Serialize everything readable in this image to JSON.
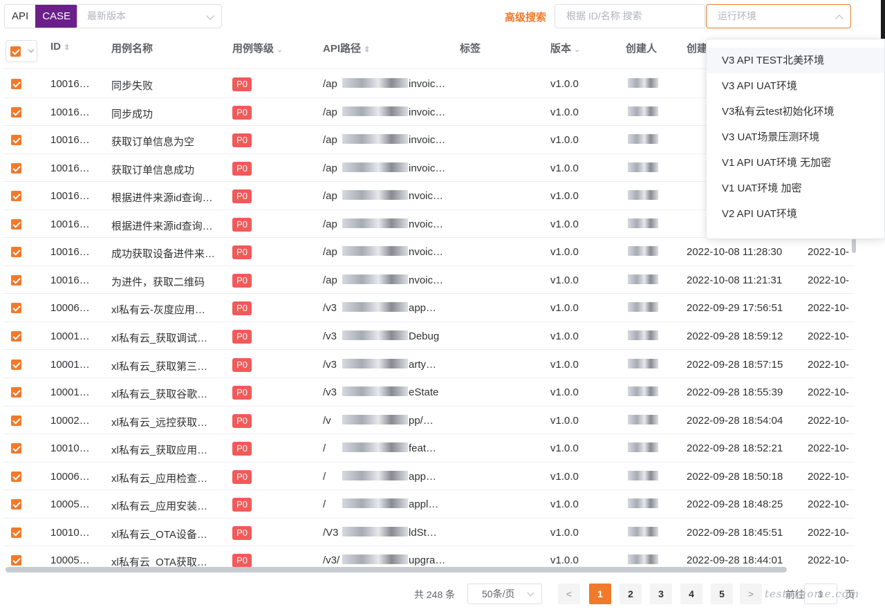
{
  "topbar": {
    "tab_api": "API",
    "tab_case": "CASE",
    "version_placeholder": "最新版本",
    "advanced_search": "高级搜索",
    "search_placeholder": "根据 ID/名称 搜索",
    "env_placeholder": "运行环境",
    "accent_color": "#f07a2a",
    "case_tab_color": "#6b1f8a"
  },
  "table": {
    "headers": {
      "id": "ID",
      "name": "用例名称",
      "level": "用例等级",
      "api_path": "API路径",
      "tags": "标签",
      "version": "版本",
      "creator": "创建人",
      "created": "创建"
    },
    "rows": [
      {
        "id": "10016…",
        "name": "同步失败",
        "level": "P0",
        "path": "/ap",
        "path_end": "invoic…",
        "version": "v1.0.0",
        "created_at": "",
        "updated_at": ""
      },
      {
        "id": "10016…",
        "name": "同步成功",
        "level": "P0",
        "path": "/ap",
        "path_end": "invoic…",
        "version": "v1.0.0",
        "created_at": "",
        "updated_at": ""
      },
      {
        "id": "10016…",
        "name": "获取订单信息为空",
        "level": "P0",
        "path": "/ap",
        "path_end": "invoic…",
        "version": "v1.0.0",
        "created_at": "",
        "updated_at": ""
      },
      {
        "id": "10016…",
        "name": "获取订单信息成功",
        "level": "P0",
        "path": "/ap",
        "path_end": "invoic…",
        "version": "v1.0.0",
        "created_at": "",
        "updated_at": ""
      },
      {
        "id": "10016…",
        "name": "根据进件来源id查询…",
        "level": "P0",
        "path": "/ap",
        "path_end": "nvoic…",
        "version": "v1.0.0",
        "created_at": "",
        "updated_at": ""
      },
      {
        "id": "10016…",
        "name": "根据进件来源id查询…",
        "level": "P0",
        "path": "/ap",
        "path_end": "nvoic…",
        "version": "v1.0.0",
        "created_at": "",
        "updated_at": ""
      },
      {
        "id": "10016…",
        "name": "成功获取设备进件来…",
        "level": "P0",
        "path": "/ap",
        "path_end": "nvoic…",
        "version": "v1.0.0",
        "created_at": "2022-10-08 11:28:30",
        "updated_at": "2022-10-"
      },
      {
        "id": "10016…",
        "name": "为进件，获取二维码",
        "level": "P0",
        "path": "/ap",
        "path_end": "nvoic…",
        "version": "v1.0.0",
        "created_at": "2022-10-08 11:21:31",
        "updated_at": "2022-10-"
      },
      {
        "id": "10006…",
        "name": "xl私有云-灰度应用…",
        "level": "P0",
        "path": "/v3",
        "path_end": "app…",
        "version": "v1.0.0",
        "created_at": "2022-09-29 17:56:51",
        "updated_at": "2022-10-"
      },
      {
        "id": "10001…",
        "name": "xl私有云_获取调试…",
        "level": "P0",
        "path": "/v3",
        "path_end": "Debug",
        "version": "v1.0.0",
        "created_at": "2022-09-28 18:59:12",
        "updated_at": "2022-10-"
      },
      {
        "id": "10001…",
        "name": "xl私有云_获取第三…",
        "level": "P0",
        "path": "/v3",
        "path_end": "arty…",
        "version": "v1.0.0",
        "created_at": "2022-09-28 18:57:15",
        "updated_at": "2022-10-"
      },
      {
        "id": "10001…",
        "name": "xl私有云_获取谷歌…",
        "level": "P0",
        "path": "/v3",
        "path_end": "eState",
        "version": "v1.0.0",
        "created_at": "2022-09-28 18:55:39",
        "updated_at": "2022-10-"
      },
      {
        "id": "10002…",
        "name": "xl私有云_远控获取…",
        "level": "P0",
        "path": "/v",
        "path_end": "pp/…",
        "version": "v1.0.0",
        "created_at": "2022-09-28 18:54:04",
        "updated_at": "2022-10-"
      },
      {
        "id": "10010…",
        "name": "xl私有云_获取应用…",
        "level": "P0",
        "path": "/",
        "path_end": "feat…",
        "version": "v1.0.0",
        "created_at": "2022-09-28 18:52:21",
        "updated_at": "2022-10-"
      },
      {
        "id": "10006…",
        "name": "xl私有云_应用检查…",
        "level": "P0",
        "path": "/",
        "path_end": "app…",
        "version": "v1.0.0",
        "created_at": "2022-09-28 18:50:18",
        "updated_at": "2022-10-"
      },
      {
        "id": "10005…",
        "name": "xl私有云_应用安装…",
        "level": "P0",
        "path": "/",
        "path_end": "appl…",
        "version": "v1.0.0",
        "created_at": "2022-09-28 18:48:25",
        "updated_at": "2022-10-"
      },
      {
        "id": "10010…",
        "name": "xl私有云_OTA设备…",
        "level": "P0",
        "path": "/V3",
        "path_end": "ldSt…",
        "version": "v1.0.0",
        "created_at": "2022-09-28 18:45:51",
        "updated_at": "2022-10-"
      },
      {
        "id": "10005…",
        "name": "xl私有云_OTA获取…",
        "level": "P0",
        "path": "/v3/",
        "path_end": "upgra…",
        "version": "v1.0.0",
        "created_at": "2022-09-28 18:44:01",
        "updated_at": "2022-10-"
      }
    ]
  },
  "env_dropdown": {
    "items": [
      "V3 API TEST北美环境",
      "V3 API UAT环境",
      "V3私有云test初始化环境",
      "V3 UAT场景压测环境",
      "V1 API UAT环境 无加密",
      "V1 UAT环境 加密",
      "V2 API UAT环境"
    ]
  },
  "pagination": {
    "total": "共 248 条",
    "page_size": "50条/页",
    "pages": [
      "1",
      "2",
      "3",
      "4",
      "5"
    ],
    "current_page": "1",
    "goto_label": "前往",
    "goto_value": "1",
    "page_unit": "页",
    "prev": "<",
    "next": ">"
  },
  "watermark": "testerhome.com"
}
